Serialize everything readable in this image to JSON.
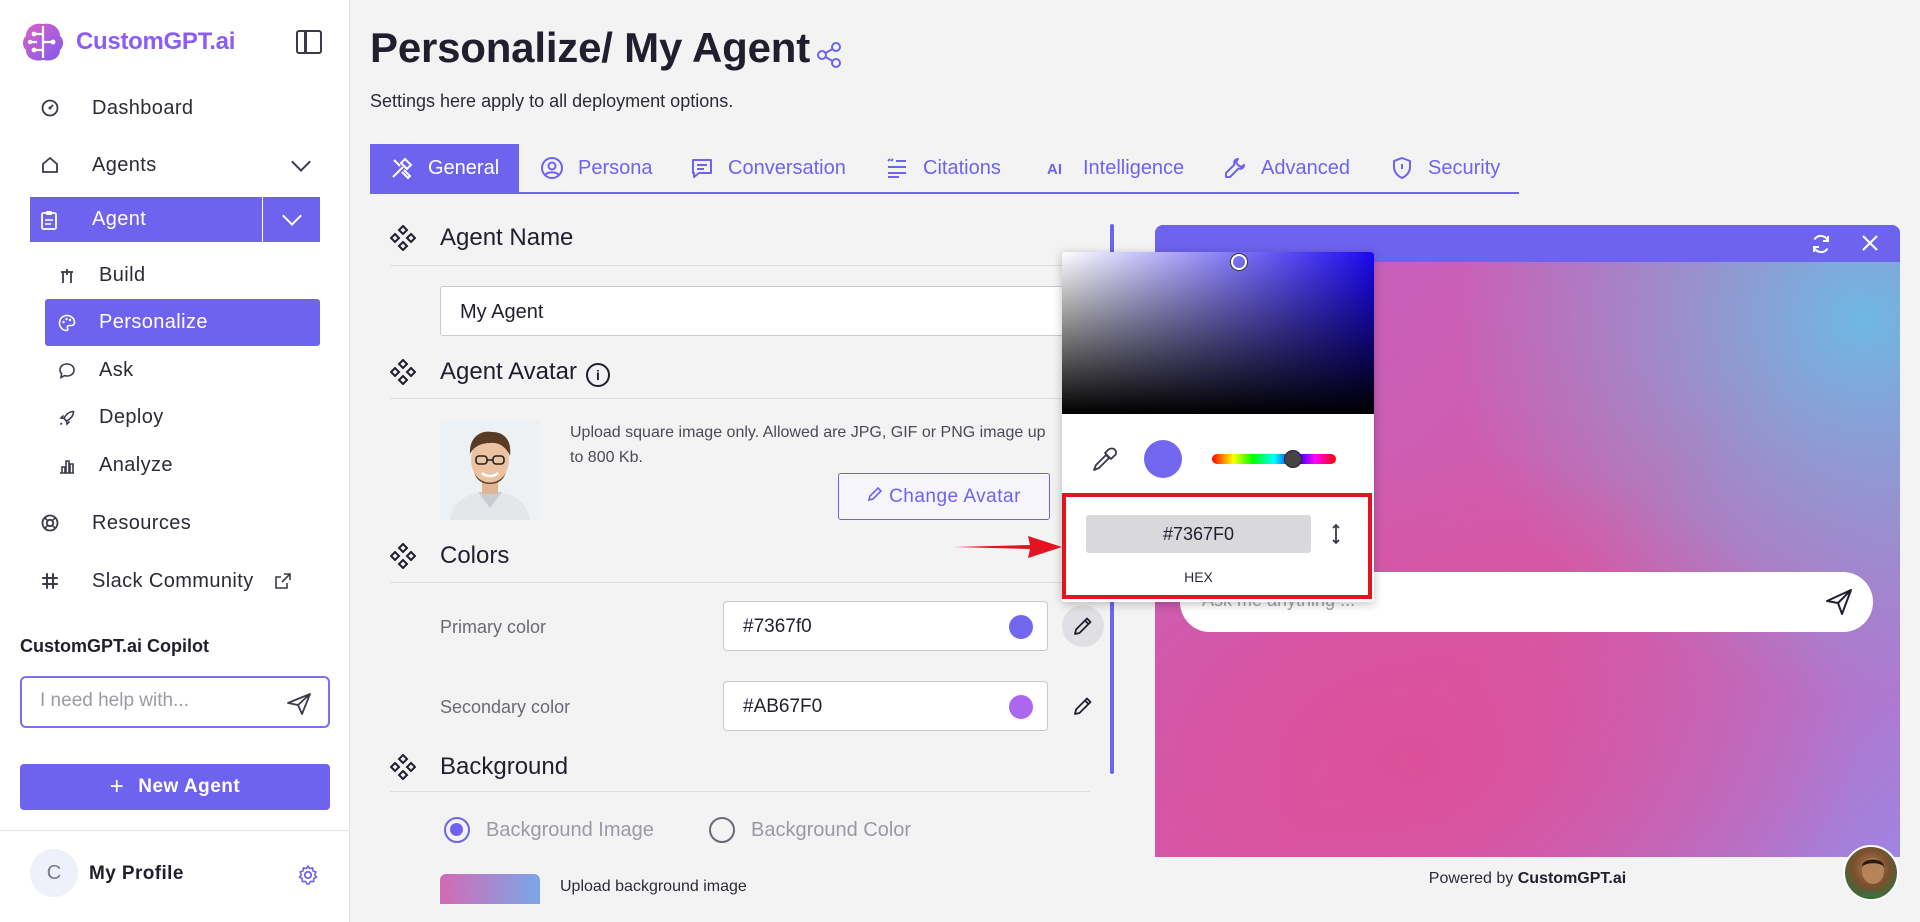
{
  "sidebar": {
    "brand": "CustomGPT.ai",
    "nav": [
      {
        "label": "Dashboard",
        "icon": "dashboard-icon"
      },
      {
        "label": "Agents",
        "icon": "home-icon"
      }
    ],
    "agent_section": {
      "label": "Agent",
      "icon": "clipboard-icon"
    },
    "sub_items": [
      {
        "label": "Build",
        "icon": "build-icon"
      },
      {
        "label": "Personalize",
        "icon": "palette-icon",
        "active": true
      },
      {
        "label": "Ask",
        "icon": "chat-icon"
      },
      {
        "label": "Deploy",
        "icon": "rocket-icon"
      },
      {
        "label": "Analyze",
        "icon": "bar-chart-icon"
      }
    ],
    "bottom_nav": [
      {
        "label": "Resources",
        "icon": "lifebuoy-icon"
      },
      {
        "label": "Slack Community",
        "icon": "slack-icon"
      }
    ],
    "copilot": {
      "title": "CustomGPT.ai Copilot",
      "placeholder": "I need help with..."
    },
    "new_agent_label": "New Agent",
    "profile": {
      "initial": "C",
      "name": "My Profile"
    }
  },
  "header": {
    "title": "Personalize/ My Agent",
    "subtitle": "Settings here apply to all deployment options."
  },
  "tabs": [
    {
      "label": "General",
      "active": true
    },
    {
      "label": "Persona"
    },
    {
      "label": "Conversation"
    },
    {
      "label": "Citations"
    },
    {
      "label": "Intelligence"
    },
    {
      "label": "Advanced"
    },
    {
      "label": "Security"
    }
  ],
  "sections": {
    "agent_name": {
      "title": "Agent Name",
      "value": "My Agent"
    },
    "agent_avatar": {
      "title": "Agent Avatar",
      "note": "Upload square image only. Allowed are JPG, GIF or PNG image up to 800 Kb.",
      "button": "Change Avatar"
    },
    "colors": {
      "title": "Colors",
      "primary": {
        "label": "Primary color",
        "value": "#7367f0",
        "color": "#7367f0"
      },
      "secondary": {
        "label": "Secondary color",
        "value": "#AB67F0",
        "color": "#ab67f0"
      }
    },
    "background": {
      "title": "Background",
      "options": [
        "Background Image",
        "Background Color"
      ],
      "selected": "Background Image",
      "upload_label": "Upload background image"
    }
  },
  "color_picker": {
    "hex_value": "#7367F0",
    "mode_label": "HEX",
    "swatch_color": "#7367f0"
  },
  "preview": {
    "input_placeholder": "Ask me anything ...",
    "powered_prefix": "Powered by ",
    "powered_brand": "CustomGPT.ai"
  },
  "colors": {
    "accent": "#6e63ee",
    "highlight": "#e3141d"
  }
}
